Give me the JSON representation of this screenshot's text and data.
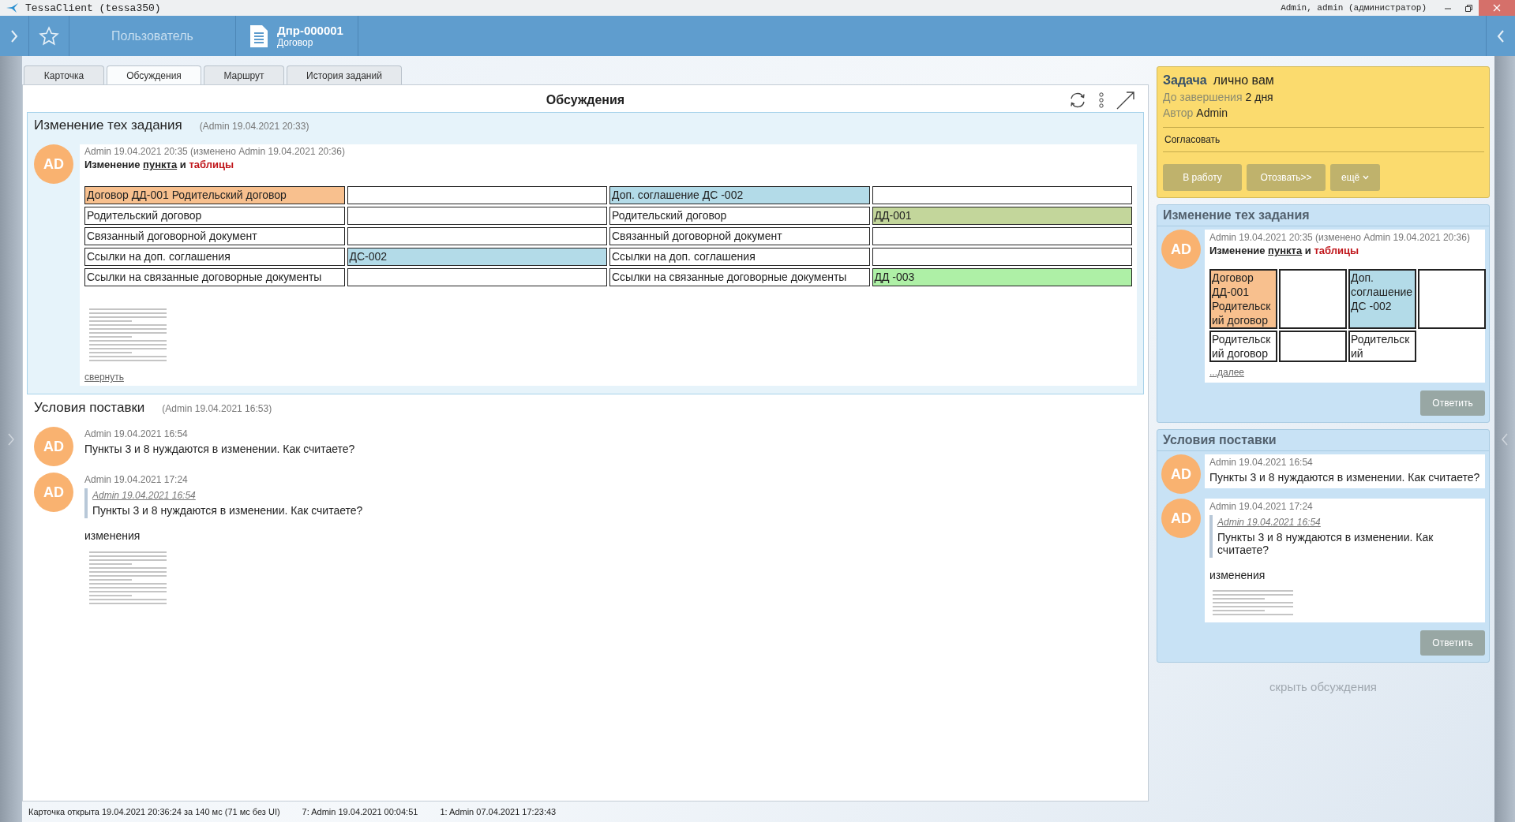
{
  "titlebar": {
    "app_title": "TessaClient (tessa350)",
    "user": "Admin, admin (администратор)"
  },
  "header": {
    "section": "Пользователь",
    "doc_number": "Дпр-000001",
    "doc_type": "Договор"
  },
  "tabs": [
    {
      "label": "Карточка",
      "selected": false
    },
    {
      "label": "Обсуждения",
      "selected": true
    },
    {
      "label": "Маршрут",
      "selected": false
    },
    {
      "label": "История заданий",
      "selected": false
    }
  ],
  "discussions": {
    "title": "Обсуждения",
    "topics": [
      {
        "title": "Изменение тех задания",
        "meta": "(Admin 19.04.2021 20:33)",
        "expanded": true,
        "messages": [
          {
            "avatar": "AD",
            "author_line": "Admin 19.04.2021 20:35  (изменено  Admin 19.04.2021 20:36)",
            "heading": [
              {
                "text": "Изменение ",
                "kind": "plain"
              },
              {
                "text": "пункта",
                "kind": "underline"
              },
              {
                "text": " и ",
                "kind": "plain"
              },
              {
                "text": "таблицы",
                "kind": "red"
              }
            ],
            "table": [
              {
                "column_1": {
                  "text": "Договор ДД-001  Родительский договор",
                  "color": "#f8c08e"
                },
                "column_3": {
                  "text": "Доп. соглашение ДС -002",
                  "color": "#b3dbe8"
                }
              },
              {
                "column_1": {
                  "text": "Родительский договор"
                },
                "column_3": {
                  "text": "Родительский договор"
                },
                "column_4": {
                  "text": "ДД-001",
                  "color": "#c3d69b"
                }
              },
              {
                "column_1": {
                  "text": "Связанный договорной документ"
                },
                "column_3": {
                  "text": "Связанный договорной документ"
                }
              },
              {
                "column_1": {
                  "text": "Ссылки на доп. соглашения"
                },
                "column_2": {
                  "text": "ДС-002",
                  "color": "#b3dbe8"
                },
                "column_3": {
                  "text": "Ссылки на доп. соглашения"
                }
              },
              {
                "column_1": {
                  "text": "Ссылки на связанные договорные документы"
                },
                "column_3": {
                  "text": "Ссылки на связанные договорные документы"
                },
                "column_4": {
                  "text": "ДД -003",
                  "color": "#aef0a6"
                }
              }
            ],
            "attachment": true,
            "collapse_link": "свернуть"
          }
        ]
      },
      {
        "title": "Условия поставки",
        "meta": "(Admin 19.04.2021 16:53)",
        "expanded": false,
        "messages": [
          {
            "avatar": "AD",
            "author_line": "Admin 19.04.2021 16:54",
            "text": "Пункты 3 и 8 нуждаются в изменении. Как считаете?"
          },
          {
            "avatar": "AD",
            "author_line": "Admin 19.04.2021 17:24",
            "quote": {
              "author": "Admin 19.04.2021 16:54",
              "text": "Пункты 3 и 8 нуждаются в изменении. Как считаете?"
            },
            "text": "изменения",
            "attachment": true
          }
        ]
      }
    ]
  },
  "task": {
    "label": "Задача",
    "assignee": "лично вам",
    "due_label": "До завершения",
    "due": "2 дня",
    "author_label": "Автор",
    "author": "Admin",
    "action": "Согласовать",
    "buttons": [
      {
        "label": "В работу",
        "kind": "plain"
      },
      {
        "label": "Отозвать>>",
        "kind": "plain"
      },
      {
        "label": "ещё",
        "kind": "menu"
      }
    ]
  },
  "side_topics": [
    {
      "title": "Изменение тех задания",
      "reply_button": "Ответить",
      "messages": [
        {
          "avatar": "AD",
          "author_line": "Admin 19.04.2021 20:35  (изменено  Admin 19.04.2021 20:36)",
          "heading": [
            {
              "text": "Изменение ",
              "kind": "plain"
            },
            {
              "text": "пункта",
              "kind": "underline"
            },
            {
              "text": " и ",
              "kind": "plain"
            },
            {
              "text": "таблицы",
              "kind": "red"
            }
          ],
          "table": [
            {
              "column_1": {
                "text": "Договор ДД-001 Родительский договор",
                "color": "#f8c08e"
              },
              "column_3": {
                "text": "Доп. соглашение ДС -002",
                "color": "#b3dbe8"
              }
            },
            {
              "column_1": {
                "text": "Родительский договор"
              },
              "column_3": {
                "text": "Родительский"
              },
              "cut": true
            }
          ],
          "more_link": "...далее"
        }
      ]
    },
    {
      "title": "Условия поставки",
      "reply_button": "Ответить",
      "messages": [
        {
          "avatar": "AD",
          "author_line": "Admin 19.04.2021 16:54",
          "text": "Пункты 3 и 8 нуждаются в изменении. Как считаете?"
        },
        {
          "avatar": "AD",
          "author_line": "Admin 19.04.2021 17:24",
          "quote": {
            "author": "Admin 19.04.2021 16:54",
            "text": "Пункты 3 и 8 нуждаются в изменении. Как считаете?"
          },
          "text": "изменения",
          "attachment": true
        }
      ]
    }
  ],
  "hide_link": "скрыть обсуждения",
  "status_bar": [
    "Карточка открыта 19.04.2021 20:36:24 за 140 мс (71 мс без UI)",
    "7:  Admin  19.04.2021 00:04:51",
    "1:  Admin  07.04.2021 17:23:43"
  ]
}
